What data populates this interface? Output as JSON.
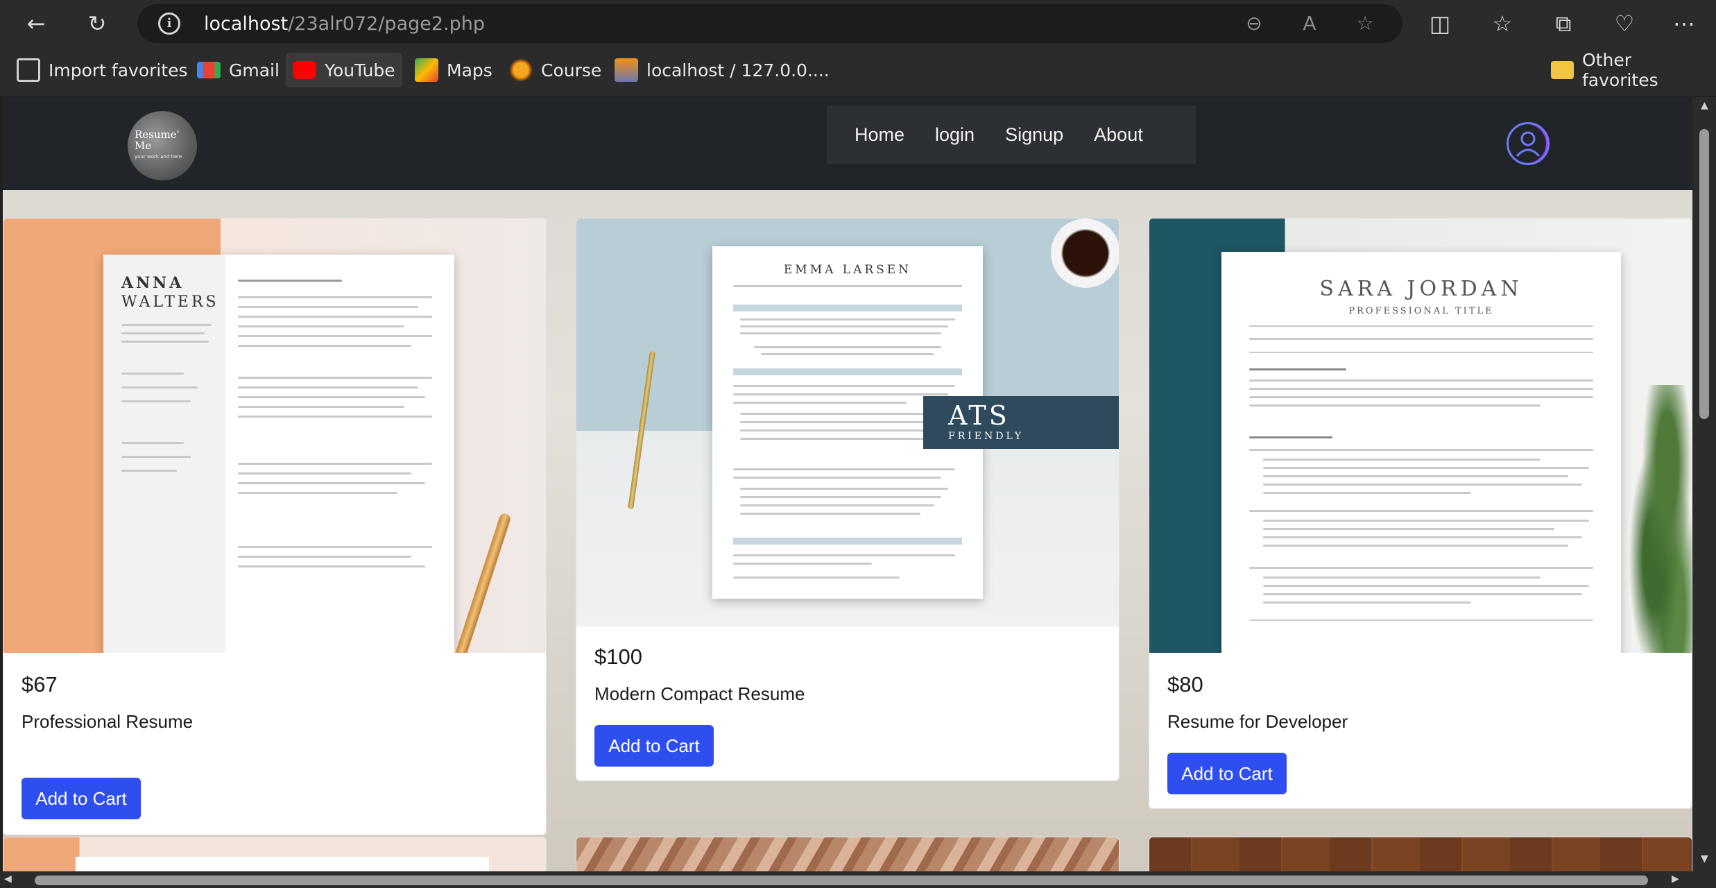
{
  "browser": {
    "url_host": "localhost",
    "url_path": "/23alr072/page2.php",
    "bookmarks": [
      "Import favorites",
      "Gmail",
      "YouTube",
      "Maps",
      "Course",
      "localhost / 127.0.0...."
    ],
    "other_favorites": "Other favorites"
  },
  "site": {
    "logo_line1": "Resume'",
    "logo_line2": "Me",
    "logo_sub": "your work and here",
    "nav": [
      "Home",
      "login",
      "Signup",
      "About"
    ]
  },
  "products": [
    {
      "price": "$67",
      "title": "Professional Resume",
      "button": "Add to Cart",
      "resume_name1": "ANNA",
      "resume_name2": "WALTERS"
    },
    {
      "price": "$100",
      "title": "Modern Compact Resume",
      "button": "Add to Cart",
      "resume_name1": "EMMA LARSEN",
      "badge1": "ATS",
      "badge2": "FRIENDLY"
    },
    {
      "price": "$80",
      "title": "Resume for Developer",
      "button": "Add to Cart",
      "resume_name1": "SARA JORDAN",
      "resume_sub": "PROFESSIONAL TITLE"
    }
  ],
  "colors": {
    "accent": "#2f4ef0",
    "navbar": "#212529"
  }
}
